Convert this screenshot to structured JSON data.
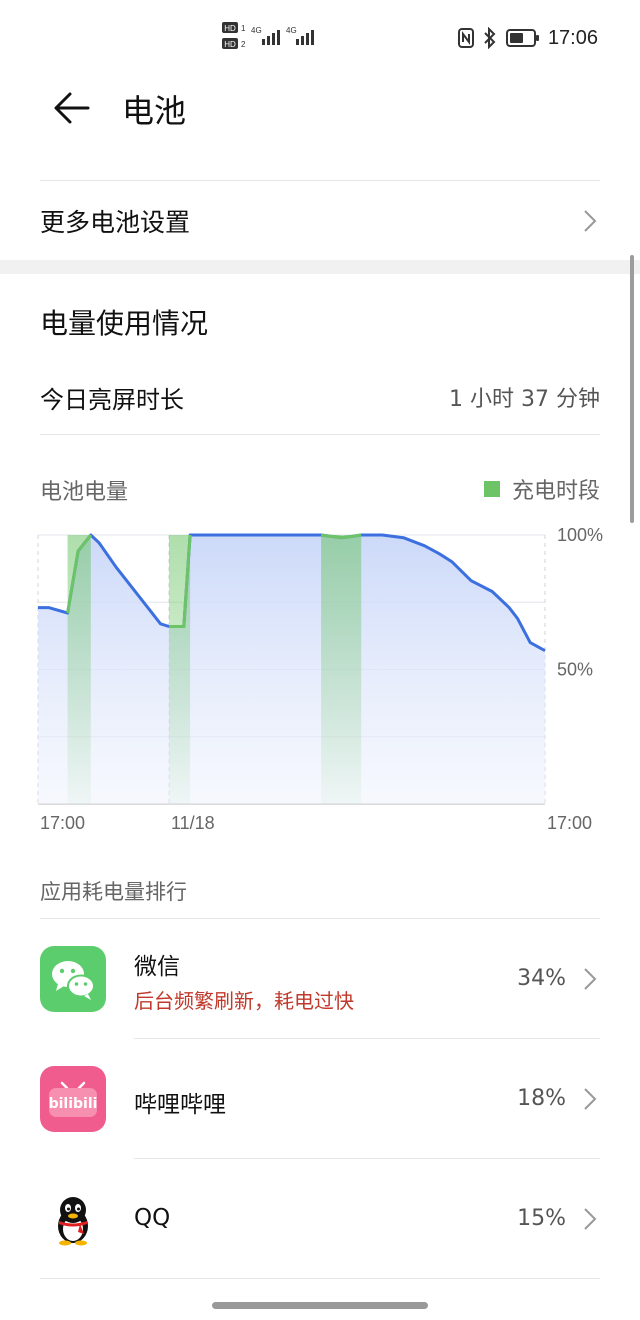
{
  "status_bar": {
    "time": "17:06",
    "sim1_badge": "HD",
    "sim2_badge": "HD",
    "network1": "4G",
    "network2": "4G",
    "icons": [
      "hd-signal-icon",
      "nfc-icon",
      "bluetooth-icon",
      "battery-icon"
    ]
  },
  "header": {
    "title": "电池",
    "back_icon": "back-arrow-icon"
  },
  "more_settings": {
    "label": "更多电池设置",
    "chevron_icon": "chevron-right-icon"
  },
  "usage": {
    "section_title": "电量使用情况",
    "screen_time_label": "今日亮屏时长",
    "screen_time_value": "1 小时 37 分钟"
  },
  "chart_data": {
    "type": "area",
    "label": "电池电量",
    "legend": [
      {
        "name": "充电时段",
        "color": "#6cc466"
      }
    ],
    "x_tick_labels": [
      "17:00",
      "11/18",
      "17:00"
    ],
    "y_tick_labels": [
      "100%",
      "50%"
    ],
    "ylim": [
      0,
      100
    ],
    "xlim": [
      0,
      24
    ],
    "x": [
      0,
      0.5,
      1.4,
      1.9,
      2.5,
      2.9,
      3.7,
      4.5,
      5.8,
      6.2,
      6.6,
      6.9,
      7.2,
      8,
      9,
      10,
      11.5,
      12.4,
      13.4,
      14.4,
      15.3,
      16.3,
      17.3,
      18.3,
      19,
      19.6,
      20.5,
      21.5,
      22.3,
      22.7,
      23.3,
      24
    ],
    "y": [
      73,
      73,
      71,
      94,
      100,
      97,
      88,
      80,
      67,
      66,
      66,
      66,
      100,
      100,
      100,
      100,
      100,
      100,
      100,
      99,
      100,
      100,
      99,
      96,
      93,
      90,
      83,
      79,
      73,
      69,
      60,
      57
    ],
    "charging_periods": [
      [
        1.4,
        2.5
      ],
      [
        6.2,
        7.2
      ],
      [
        13.4,
        15.3
      ]
    ],
    "charging_color": "#6cc466",
    "line_color": "#3c6fe0",
    "fill_color": "#c9d7f8",
    "grid": true
  },
  "ranking": {
    "title": "应用耗电量排行",
    "apps": [
      {
        "name": "微信",
        "warning": "后台频繁刷新，耗电过快",
        "percent": "34%",
        "icon": "wechat-icon"
      },
      {
        "name": "哔哩哔哩",
        "warning": "",
        "percent": "18%",
        "icon": "bilibili-icon",
        "icon_text": "bilibili"
      },
      {
        "name": "QQ",
        "warning": "",
        "percent": "15%",
        "icon": "qq-penguin-icon"
      }
    ]
  },
  "colors": {
    "accent_green": "#6cc466",
    "line_blue": "#3c6fe0",
    "warning_red": "#c0392b",
    "wechat_green": "#5ccd6c",
    "bilibili_pink": "#ef5c8d"
  }
}
